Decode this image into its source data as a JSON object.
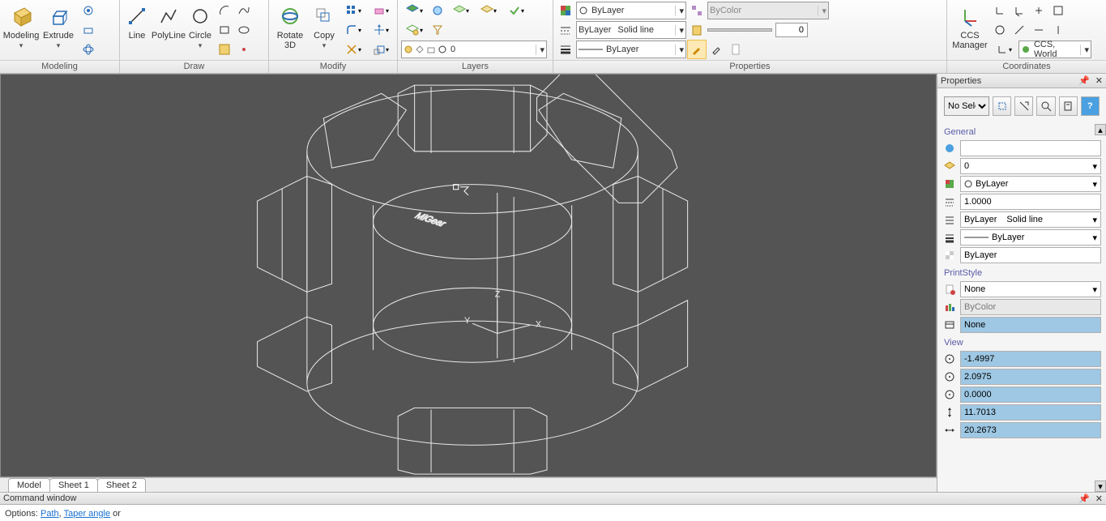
{
  "ribbon": {
    "modeling": {
      "title": "Modeling",
      "modeling_btn": "Modeling",
      "extrude_btn": "Extrude"
    },
    "draw": {
      "title": "Draw",
      "line": "Line",
      "polyline": "PolyLine",
      "circle": "Circle"
    },
    "modify": {
      "title": "Modify",
      "rotate3d": "Rotate\n3D",
      "copy": "Copy"
    },
    "layers": {
      "title": "Layers",
      "layer_combo": "0"
    },
    "properties": {
      "title": "Properties",
      "color_combo": "ByLayer",
      "bycolor_combo": "ByColor",
      "linetype_combo_left": "ByLayer",
      "linetype_combo_right": "Solid line",
      "lineweight_combo": "ByLayer",
      "slider_value": "0"
    },
    "coordinates": {
      "title": "Coordinates",
      "ccs_manager": "CCS\nManager",
      "ccs_world": "CCS, World"
    }
  },
  "viewport": {
    "text3d": "MiGear",
    "axis_x": "X",
    "axis_y": "Y",
    "axis_z": "Z"
  },
  "sheet_tabs": [
    "Model",
    "Sheet 1",
    "Sheet 2"
  ],
  "properties_panel": {
    "title": "Properties",
    "selector": "No Sele",
    "group_general": "General",
    "layer": "0",
    "color": "ByLayer",
    "scale": "1.0000",
    "lt_left": "ByLayer",
    "lt_right": "Solid line",
    "lineweight": "ByLayer",
    "transparency": "ByLayer",
    "group_printstyle": "PrintStyle",
    "ps1": "None",
    "ps2": "ByColor",
    "ps3": "None",
    "group_view": "View",
    "vx": "-1.4997",
    "vy": "2.0975",
    "vz": "0.0000",
    "vh": "11.7013",
    "vw": "20.2673"
  },
  "command": {
    "title": "Command window",
    "prefix": "Options: ",
    "link1": "Path",
    "sep": ", ",
    "link2": "Taper angle",
    "suffix": " or"
  }
}
